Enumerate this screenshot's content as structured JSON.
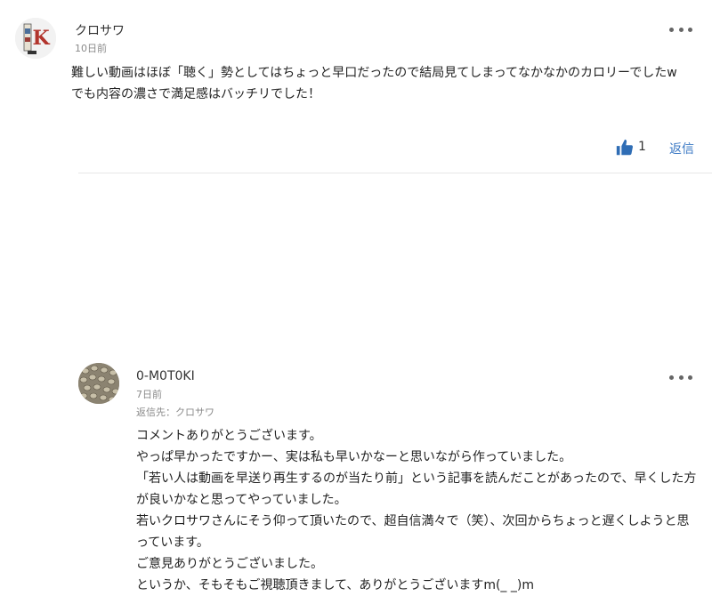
{
  "comments": [
    {
      "author": "クロサワ",
      "date": "10日前",
      "lines": [
        "難しい動画はほぼ「聴く」勢としてはちょっと早口だったので結局見てしまってなかなかのカロリーでしたw",
        "でも内容の濃さで満足感はバッチリでした！"
      ],
      "likes": "1",
      "reply_label": "返信",
      "avatar_letter": "K"
    }
  ],
  "reply": {
    "author": "0-M0T0KI",
    "date": "7日前",
    "reply_to": "返信先：クロサワ",
    "lines": [
      "コメントありがとうございます。",
      "やっぱ早かったですかー、実は私も早いかなーと思いながら作っていました。",
      "「若い人は動画を早送り再生するのが当たり前」という記事を読んだことがあったので、早くした方が良いかなと思ってやっていました。",
      "若いクロサワさんにそう仰って頂いたので、超自信満々で（笑）、次回からちょっと遅くしようと思っています。",
      "ご意見ありがとうございました。",
      "というか、そもそもご視聴頂きまして、ありがとうございますm(_ _)m"
    ]
  },
  "colors": {
    "accent": "#3a78c4",
    "like_icon": "#2f6db5",
    "muted_text": "#8a8a8a"
  },
  "icons": [
    "avatar",
    "more-options-icon",
    "thumbs-up-icon"
  ]
}
